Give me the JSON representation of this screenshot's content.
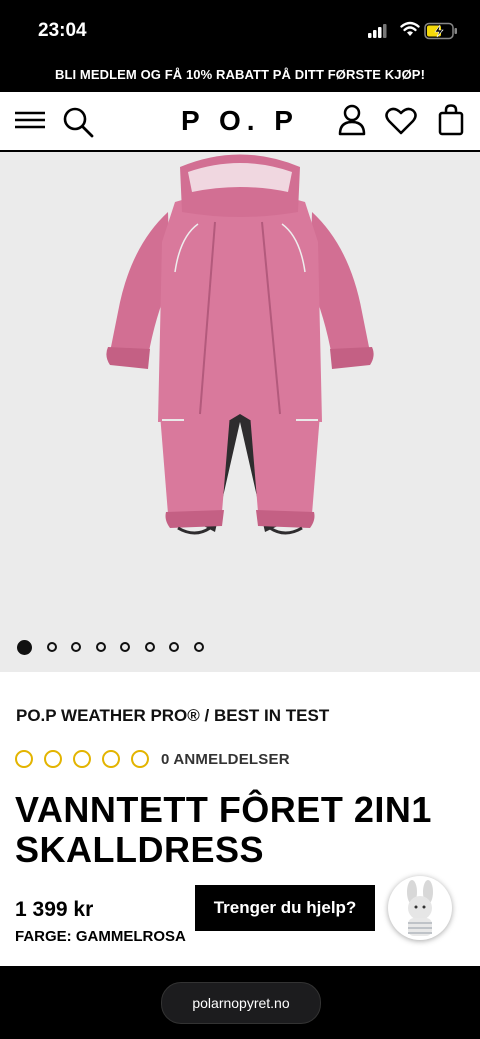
{
  "status_bar": {
    "time": "23:04"
  },
  "promo_banner": {
    "text": "BLI MEDLEM OG FÅ 10% RABATT PÅ DITT FØRSTE KJØP!"
  },
  "header": {
    "logo": "P O. P",
    "icons": [
      "menu-icon",
      "search-icon",
      "account-icon",
      "heart-icon",
      "bag-icon"
    ]
  },
  "gallery": {
    "image_count": 8,
    "active_index": 0
  },
  "product": {
    "breadcrumb": "PO.P WEATHER PRO® / BEST IN TEST",
    "rating": 0,
    "rating_max": 5,
    "reviews": "0 ANMELDELSER",
    "title": "VANNTETT FÔRET 2IN1 SKALLDRESS",
    "price": "1 399 kr",
    "color": "FARGE: GAMMELROSA"
  },
  "help_button": {
    "label": "Trenger du hjelp?"
  },
  "browser": {
    "url": "polarnopyret.no"
  },
  "colors": {
    "accent": "#000000",
    "star": "#e3b400",
    "product": "#d16e93"
  }
}
